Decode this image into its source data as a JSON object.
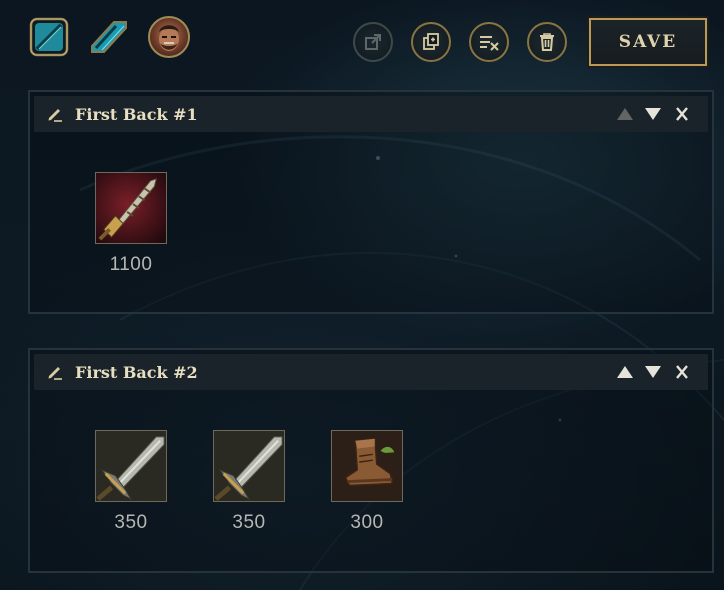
{
  "toolbar": {
    "left_icons": [
      "map-summoners-rift-icon",
      "map-howling-abyss-icon",
      "champion-portrait"
    ],
    "buttons": [
      {
        "name": "export-button",
        "icon": "external-link-icon",
        "enabled": false
      },
      {
        "name": "duplicate-button",
        "icon": "copy-icon",
        "enabled": true
      },
      {
        "name": "clear-button",
        "icon": "clear-list-icon",
        "enabled": true
      },
      {
        "name": "delete-button",
        "icon": "trash-icon",
        "enabled": true
      }
    ],
    "save_label": "SAVE"
  },
  "blocks": [
    {
      "title": "First Back #1",
      "move_up_enabled": false,
      "move_down_enabled": true,
      "items": [
        {
          "icon": "serrated-dirk-icon",
          "price": "1100"
        }
      ]
    },
    {
      "title": "First Back #2",
      "move_up_enabled": true,
      "move_down_enabled": true,
      "items": [
        {
          "icon": "long-sword-icon",
          "price": "350"
        },
        {
          "icon": "long-sword-icon",
          "price": "350"
        },
        {
          "icon": "boots-icon",
          "price": "300"
        }
      ]
    }
  ],
  "colors": {
    "gold_border": "#b99a56",
    "panel_header": "#1a2329",
    "background": "#0b1620",
    "price_text": "#b6b7b3"
  }
}
